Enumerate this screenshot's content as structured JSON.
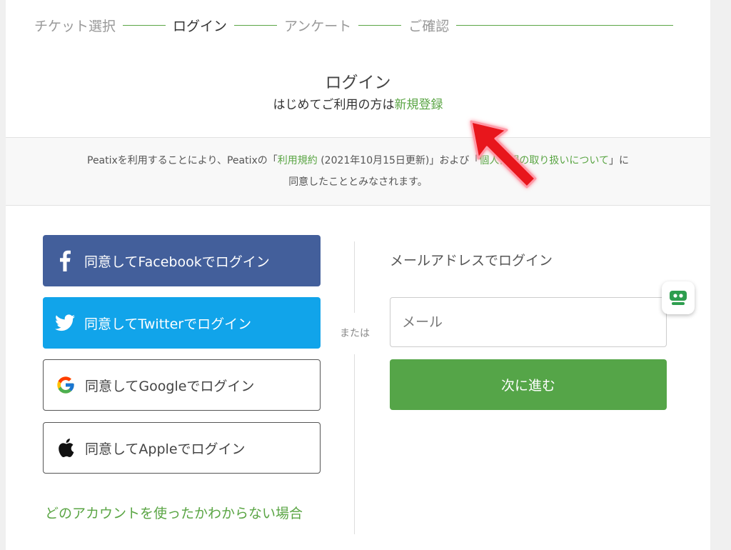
{
  "steps": {
    "step1": "チケット選択",
    "step2": "ログイン",
    "step3": "アンケート",
    "step4": "ご確認"
  },
  "header": {
    "title": "ログイン",
    "sub_prefix": "はじめてご利用の方は",
    "register_link": "新規登録"
  },
  "terms": {
    "part1": "Peatixを利用することにより、Peatixの「",
    "terms_link": "利用規約",
    "part2": " (2021年10月15日更新)」および「",
    "privacy_link": "個人情報の取り扱いについて",
    "part3": "」に",
    "line2": "同意したこととみなされます。"
  },
  "social": {
    "facebook": "同意してFacebookでログイン",
    "twitter": "同意してTwitterでログイン",
    "google": "同意してGoogleでログイン",
    "apple": "同意してAppleでログイン"
  },
  "unknown_account_link": "どのアカウントを使ったかわからない場合",
  "divider_text": "または",
  "email": {
    "title": "メールアドレスでログイン",
    "placeholder": "メール",
    "next_button": "次に進む"
  },
  "colors": {
    "accent_green": "#5aa544",
    "facebook_blue": "#435f9b",
    "twitter_blue": "#11a4ea",
    "annotation_red": "#e8141e"
  }
}
